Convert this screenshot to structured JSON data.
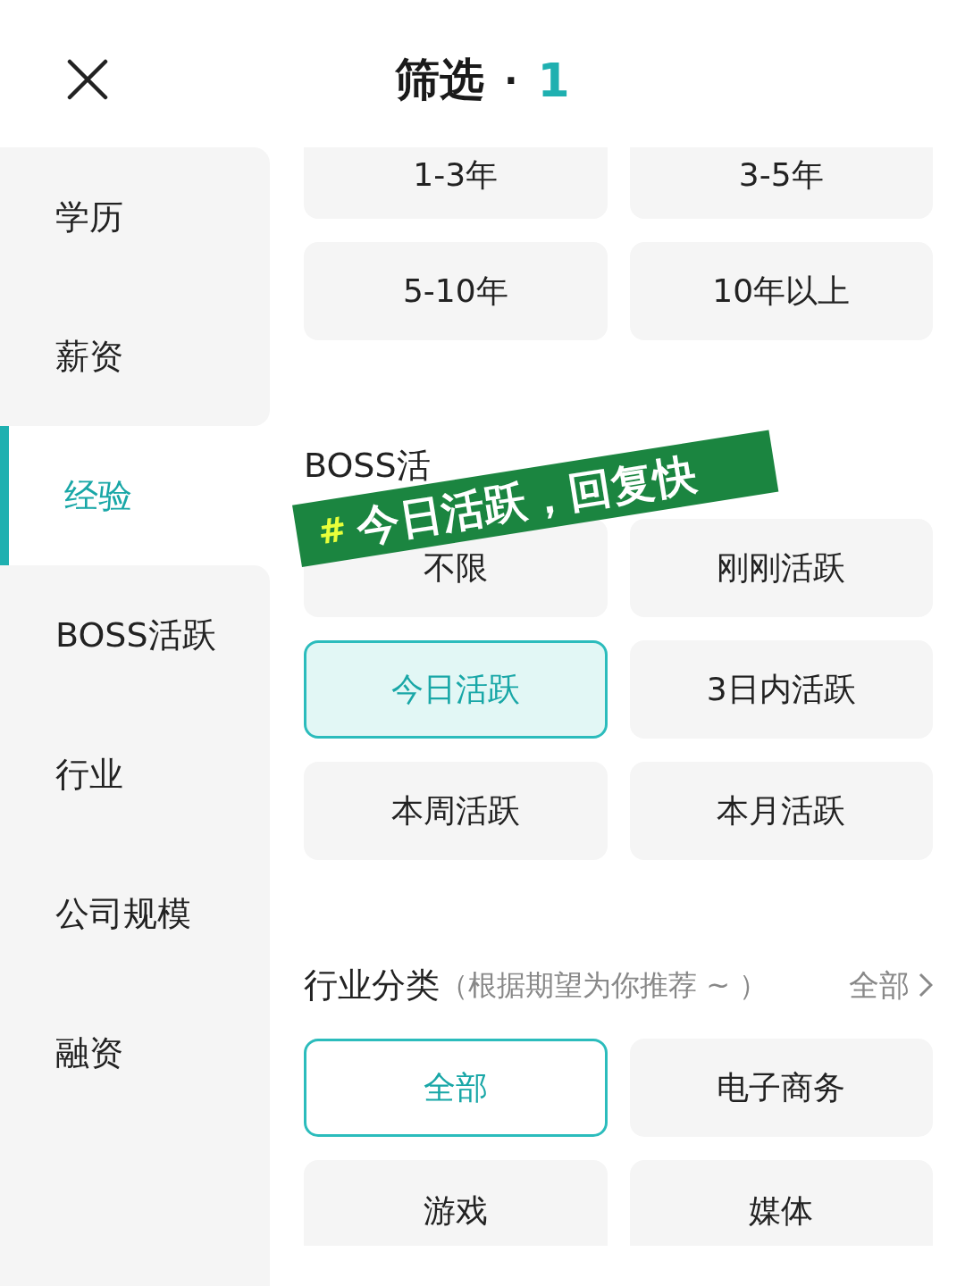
{
  "header": {
    "title": "筛选",
    "separator": "·",
    "count": "1"
  },
  "sidebar": {
    "items": [
      {
        "label": "学历",
        "selected": false
      },
      {
        "label": "薪资",
        "selected": false
      },
      {
        "label": "经验",
        "selected": true
      },
      {
        "label": "BOSS活跃",
        "selected": false
      },
      {
        "label": "行业",
        "selected": false
      },
      {
        "label": "公司规模",
        "selected": false
      },
      {
        "label": "融资",
        "selected": false
      }
    ]
  },
  "sections": [
    {
      "options": [
        {
          "label": "1-3年",
          "selected": false
        },
        {
          "label": "3-5年",
          "selected": false
        },
        {
          "label": "5-10年",
          "selected": false
        },
        {
          "label": "10年以上",
          "selected": false
        }
      ]
    },
    {
      "title": "BOSS活",
      "options": [
        {
          "label": "不限",
          "selected": false
        },
        {
          "label": "刚刚活跃",
          "selected": false
        },
        {
          "label": "今日活跃",
          "selected": true
        },
        {
          "label": "3日内活跃",
          "selected": false
        },
        {
          "label": "本周活跃",
          "selected": false
        },
        {
          "label": "本月活跃",
          "selected": false
        }
      ]
    },
    {
      "title": "行业分类",
      "hint": "（根据期望为你推荐 ~ ）",
      "more": "全部",
      "options": [
        {
          "label": "全部",
          "selected": true
        },
        {
          "label": "电子商务",
          "selected": false
        },
        {
          "label": "游戏",
          "selected": false
        },
        {
          "label": "媒体",
          "selected": false
        }
      ]
    }
  ],
  "sticker": {
    "mark": "#",
    "text": "今日活跃，回复快"
  }
}
